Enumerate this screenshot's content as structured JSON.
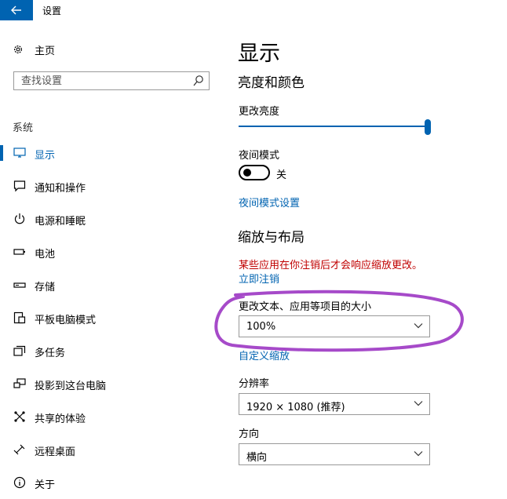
{
  "window": {
    "title": "设置"
  },
  "sidebar": {
    "home_label": "主页",
    "search_placeholder": "查找设置",
    "group_label": "系统",
    "items": [
      {
        "label": "显示",
        "icon": "monitor-icon",
        "active": true
      },
      {
        "label": "通知和操作",
        "icon": "notification-icon"
      },
      {
        "label": "电源和睡眠",
        "icon": "power-icon"
      },
      {
        "label": "电池",
        "icon": "battery-icon"
      },
      {
        "label": "存储",
        "icon": "storage-icon"
      },
      {
        "label": "平板电脑模式",
        "icon": "tablet-mode-icon"
      },
      {
        "label": "多任务",
        "icon": "multitask-icon"
      },
      {
        "label": "投影到这台电脑",
        "icon": "project-icon"
      },
      {
        "label": "共享的体验",
        "icon": "shared-experience-icon"
      },
      {
        "label": "远程桌面",
        "icon": "remote-desktop-icon"
      },
      {
        "label": "关于",
        "icon": "about-icon"
      }
    ]
  },
  "main": {
    "title": "显示",
    "brightness_section": {
      "heading": "亮度和颜色",
      "brightness_label": "更改亮度",
      "brightness_level": 1.0,
      "night_mode_label": "夜间模式",
      "night_mode_state": "关",
      "night_mode_settings_link": "夜间模式设置"
    },
    "scale_section": {
      "heading": "缩放与布局",
      "warning": "某些应用在你注销后才会响应缩放更改。",
      "signout_link": "立即注销",
      "size_label": "更改文本、应用等项目的大小",
      "size_value": "100%",
      "custom_scale_link": "自定义缩放",
      "resolution_label": "分辨率",
      "resolution_value": "1920 × 1080 (推荐)",
      "orientation_label": "方向",
      "orientation_value": "横向"
    }
  },
  "colors": {
    "accent": "#0063b1",
    "warning": "#c00000",
    "annotation": "#a64ac9"
  }
}
